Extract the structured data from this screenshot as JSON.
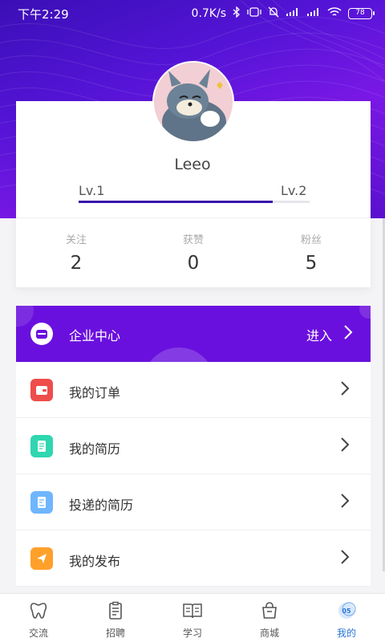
{
  "status_bar": {
    "time": "下午2:29",
    "net_speed": "0.7K/s",
    "battery": "78"
  },
  "profile": {
    "username": "Leeo",
    "level_current": "Lv.1",
    "level_next": "Lv.2",
    "level_progress": 0.84
  },
  "stats": [
    {
      "label": "关注",
      "value": "2"
    },
    {
      "label": "获赞",
      "value": "0"
    },
    {
      "label": "粉丝",
      "value": "5"
    }
  ],
  "enterprise": {
    "label": "企业中心",
    "action": "进入",
    "color": "#6a10de"
  },
  "menu": [
    {
      "label": "我的订单",
      "icon": "wallet-icon",
      "color": "#ef4c4c"
    },
    {
      "label": "我的简历",
      "icon": "document-icon",
      "color": "#2fd6b0"
    },
    {
      "label": "投递的简历",
      "icon": "edit-document-icon",
      "color": "#6fb6ff"
    },
    {
      "label": "我的发布",
      "icon": "send-icon",
      "color": "#ffa02b"
    }
  ],
  "tabs": [
    {
      "label": "交流",
      "icon": "tooth-icon",
      "active": false
    },
    {
      "label": "招聘",
      "icon": "clipboard-icon",
      "active": false
    },
    {
      "label": "学习",
      "icon": "book-icon",
      "active": false
    },
    {
      "label": "商城",
      "icon": "shopping-bag-icon",
      "active": false
    },
    {
      "label": "我的",
      "icon": "profile-badge-icon",
      "active": true
    }
  ],
  "colors": {
    "accent": "#5a12d6",
    "active_tab": "#2a74d8"
  }
}
